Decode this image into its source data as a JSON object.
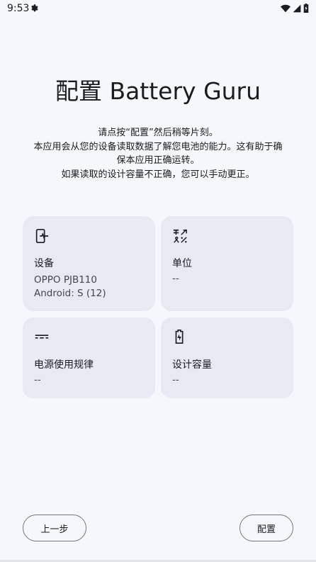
{
  "status_bar": {
    "time": "9:53",
    "icons": [
      "gear-icon",
      "wifi-icon",
      "signal-icon",
      "battery-icon"
    ]
  },
  "title": "配置 Battery Guru",
  "intro": {
    "line1": "请点按“配置”然后稍等片刻。",
    "line2": "本应用会从您的设备读取数据了解您电池的能力。这有助于确",
    "line3": "保本应用正确运转。",
    "line4": "如果读取的设计容量不正确，您可以手动更正。"
  },
  "cards": {
    "device": {
      "icon": "phone-pulse-icon",
      "label": "设备",
      "value1": "OPPO PJB110",
      "value2": "Android: S (12)"
    },
    "unit": {
      "icon": "units-icon",
      "label": "单位",
      "value": "--"
    },
    "power": {
      "icon": "dc-power-icon",
      "label": "电源使用规律",
      "value": "--"
    },
    "capacity": {
      "icon": "battery-charging-icon",
      "label": "设计容量",
      "value": "--"
    }
  },
  "buttons": {
    "back": "上一步",
    "configure": "配置"
  },
  "colors": {
    "background": "#f6f7fc",
    "card": "#e7eaf3",
    "button_border": "#757780"
  }
}
